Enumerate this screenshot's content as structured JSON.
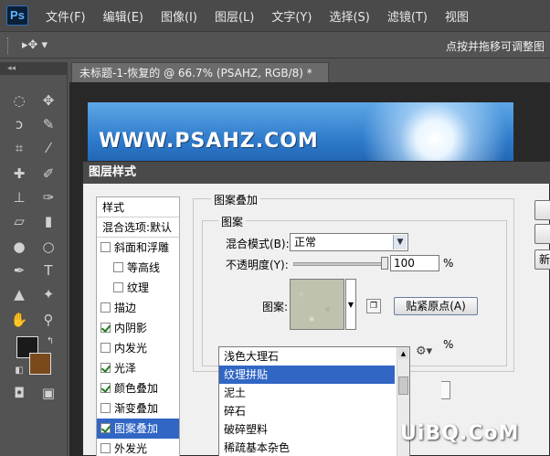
{
  "app": {
    "logo": "Ps"
  },
  "menu": [
    "文件(F)",
    "编辑(E)",
    "图像(I)",
    "图层(L)",
    "文字(Y)",
    "选择(S)",
    "滤镜(T)",
    "视图"
  ],
  "options_bar": {
    "hint": "点按并拖移可调整图"
  },
  "document_tab": {
    "title": "未标题-1-恢复的 @ 66.7% (PSAHZ, RGB/8) *"
  },
  "canvas": {
    "text": "WWW.PSAHZ.COM"
  },
  "dialog": {
    "title": "图层样式",
    "styles_header": "样式",
    "blend_options": "混合选项:默认",
    "styles": [
      {
        "label": "斜面和浮雕",
        "checked": false,
        "indent": false
      },
      {
        "label": "等高线",
        "checked": false,
        "indent": true
      },
      {
        "label": "纹理",
        "checked": false,
        "indent": true
      },
      {
        "label": "描边",
        "checked": false,
        "indent": false
      },
      {
        "label": "内阴影",
        "checked": true,
        "indent": false
      },
      {
        "label": "内发光",
        "checked": false,
        "indent": false
      },
      {
        "label": "光泽",
        "checked": true,
        "indent": false
      },
      {
        "label": "颜色叠加",
        "checked": true,
        "indent": false
      },
      {
        "label": "渐变叠加",
        "checked": false,
        "indent": false
      },
      {
        "label": "图案叠加",
        "checked": true,
        "indent": false,
        "selected": true
      },
      {
        "label": "外发光",
        "checked": false,
        "indent": false
      }
    ],
    "group_title": "图案叠加",
    "subgroup_title": "图案",
    "blend_mode_label": "混合模式(B):",
    "blend_mode_value": "正常",
    "opacity_label": "不透明度(Y):",
    "opacity_value": "100",
    "opacity_unit": "%",
    "pattern_label": "图案:",
    "snap_origin_button": "贴紧原点(A)",
    "scale_unit": "%",
    "pattern_list": [
      "浅色大理石",
      "纹理拼贴",
      "泥土",
      "碎石",
      "破碎塑料",
      "稀疏基本杂色"
    ],
    "pattern_list_selected": 1,
    "right_buttons": [
      "",
      "",
      "新"
    ]
  },
  "watermark": "UiBQ.CoM"
}
